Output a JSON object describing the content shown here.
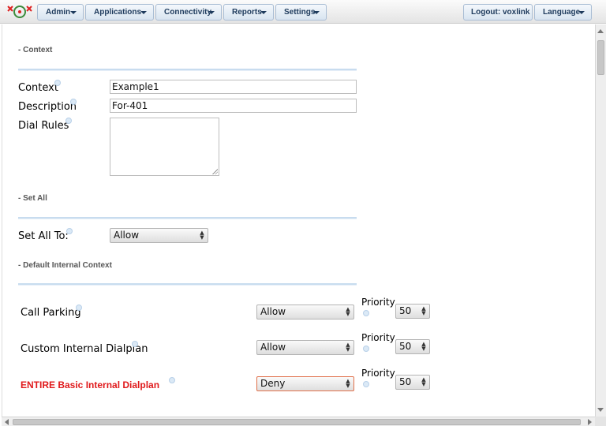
{
  "nav": {
    "logo_icon": "voxlink-logo-icon",
    "menus": [
      "Admin",
      "Applications",
      "Connectivity",
      "Reports",
      "Settings"
    ],
    "logout": "Logout: voxlink",
    "language": "Language"
  },
  "sections": {
    "context": "- Context",
    "set_all": "- Set All",
    "default_internal": "- Default Internal Context"
  },
  "context_form": {
    "context_label": "Context",
    "context_value": "Example1",
    "description_label": "Description",
    "description_value": "For-401",
    "dial_rules_label": "Dial Rules",
    "dial_rules_value": ""
  },
  "set_all": {
    "label": "Set All To:",
    "value": "Allow"
  },
  "rules": [
    {
      "label": "Call Parking",
      "value": "Allow",
      "priority_label": "Priority",
      "priority": "50",
      "highlight": false
    },
    {
      "label": "Custom Internal Dialplan",
      "value": "Allow",
      "priority_label": "Priority",
      "priority": "50",
      "highlight": false
    },
    {
      "label": "ENTIRE Basic Internal Dialplan",
      "value": "Deny",
      "priority_label": "Priority",
      "priority": "50",
      "highlight": true
    }
  ],
  "colors": {
    "highlight_label": "#e0191b",
    "nav_text": "#1d3a5c",
    "section_rule": "#c8dcef"
  }
}
